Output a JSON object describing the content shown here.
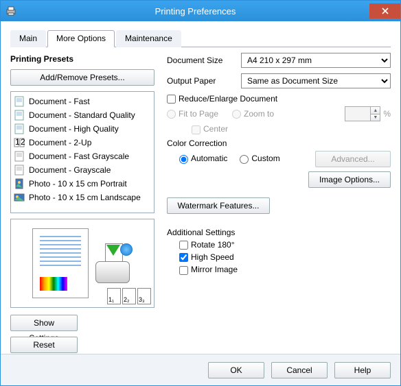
{
  "window": {
    "title": "Printing Preferences"
  },
  "tabs": {
    "main": "Main",
    "more": "More Options",
    "maint": "Maintenance"
  },
  "left": {
    "header": "Printing Presets",
    "addremove": "Add/Remove Presets...",
    "presets": [
      "Document - Fast",
      "Document - Standard Quality",
      "Document - High Quality",
      "Document - 2-Up",
      "Document - Fast Grayscale",
      "Document - Grayscale",
      "Photo - 10 x 15 cm Portrait",
      "Photo - 10 x 15 cm Landscape"
    ],
    "show": "Show Settings",
    "reset": "Reset Defaults"
  },
  "right": {
    "doc_label": "Document Size",
    "doc_value": "A4 210 x 297 mm",
    "out_label": "Output Paper",
    "out_value": "Same as Document Size",
    "reduce": "Reduce/Enlarge Document",
    "fit": "Fit to Page",
    "zoom": "Zoom to",
    "percent": "%",
    "center": "Center",
    "cc_header": "Color Correction",
    "cc_auto": "Automatic",
    "cc_custom": "Custom",
    "advanced": "Advanced...",
    "imgopt": "Image Options...",
    "watermark": "Watermark Features...",
    "add_header": "Additional Settings",
    "rotate": "Rotate 180°",
    "highspeed": "High Speed",
    "mirror": "Mirror Image"
  },
  "buttons": {
    "ok": "OK",
    "cancel": "Cancel",
    "help": "Help"
  },
  "mini": {
    "p1": "1₁",
    "p2": "2₂",
    "p3": "3₃"
  }
}
